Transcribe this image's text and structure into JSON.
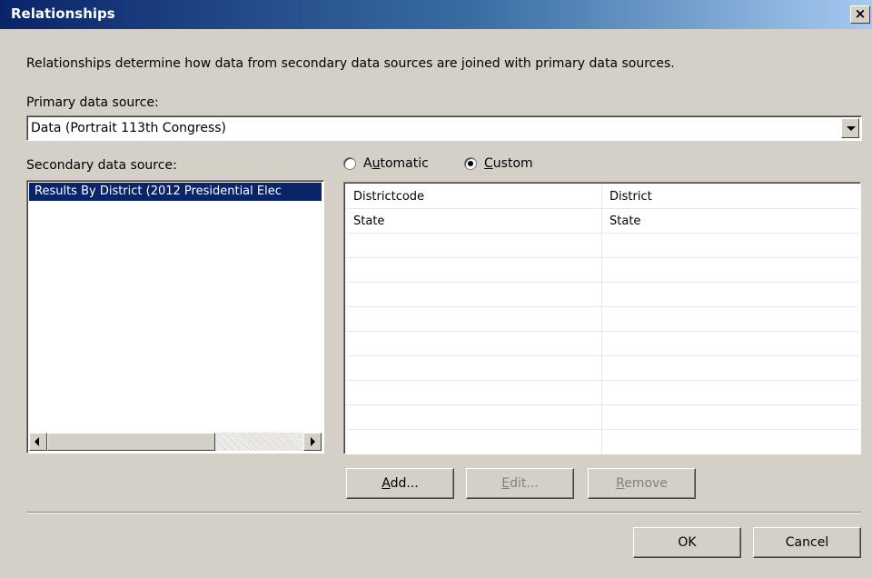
{
  "window": {
    "title": "Relationships",
    "close_glyph": "✕"
  },
  "description": "Relationships determine how data from secondary data sources are joined with primary data sources.",
  "primary": {
    "label": "Primary data source:",
    "value": "Data (Portrait 113th Congress)"
  },
  "secondary": {
    "label": "Secondary data source:",
    "items": [
      "Results By District (2012 Presidential Elec"
    ]
  },
  "mode": {
    "automatic_label": "Automatic",
    "custom_label": "Custom",
    "selected": "Custom"
  },
  "mappings": [
    {
      "primary_field": "Districtcode",
      "secondary_field": "District"
    },
    {
      "primary_field": "State",
      "secondary_field": "State"
    }
  ],
  "buttons": {
    "add": "Add...",
    "edit": "Edit...",
    "remove": "Remove",
    "ok": "OK",
    "cancel": "Cancel"
  }
}
